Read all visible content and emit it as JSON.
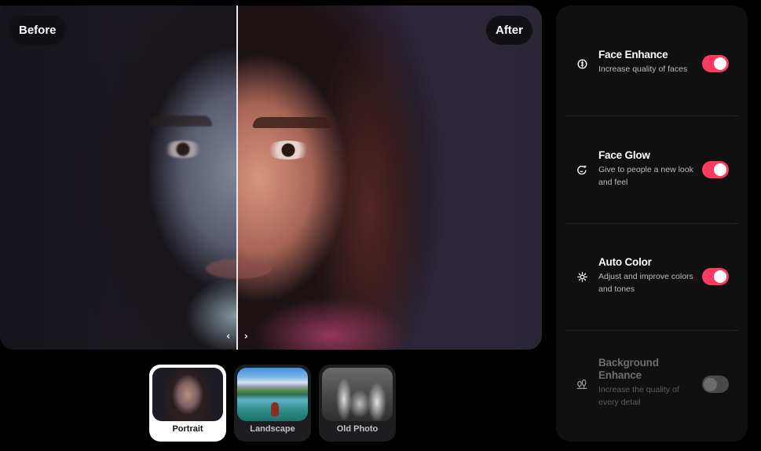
{
  "viewer": {
    "before_label": "Before",
    "after_label": "After",
    "split_percent": 43.8,
    "handle_left": "‹",
    "handle_right": "›"
  },
  "presets": [
    {
      "label": "Portrait",
      "selected": true,
      "image": "portrait-woman"
    },
    {
      "label": "Landscape",
      "selected": false,
      "image": "mountain-lake-boat"
    },
    {
      "label": "Old Photo",
      "selected": false,
      "image": "black-white-family"
    }
  ],
  "settings": {
    "options": [
      {
        "title": "Face Enhance",
        "description": "Increase quality of faces",
        "icon": "face-enhance-icon",
        "enabled": true,
        "disabled": false
      },
      {
        "title": "Face Glow",
        "description": "Give to people a new look and feel",
        "icon": "face-glow-icon",
        "enabled": true,
        "disabled": false
      },
      {
        "title": "Auto Color",
        "description": "Adjust and improve colors and tones",
        "icon": "sun-icon",
        "enabled": true,
        "disabled": false
      },
      {
        "title": "Background Enhance",
        "description": "Increase the quality of every detail",
        "icon": "trees-icon",
        "enabled": false,
        "disabled": true
      }
    ]
  },
  "colors": {
    "accent": "#fb3a60",
    "panel_bg": "#101010",
    "toggle_off": "#4a4a4a"
  }
}
